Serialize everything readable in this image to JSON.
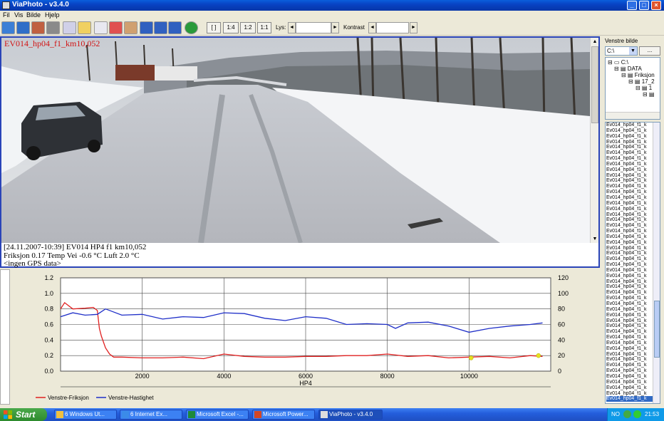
{
  "window": {
    "title": "ViaPhoto - v3.4.0"
  },
  "menu": [
    "Fil",
    "Vis",
    "Bilde",
    "Hjelp"
  ],
  "toolbar": {
    "icons": [
      "arrow-icon",
      "arrow-icon",
      "road-icon",
      "disk-icon",
      "printer-icon",
      "mail-icon",
      "document-icon",
      "chart-icon",
      "map-icon",
      "window-icon",
      "split-icon",
      "grid-icon",
      "globe-icon"
    ],
    "zoom_buttons": [
      "[ ]",
      "1:4",
      "1:2",
      "1:1"
    ],
    "brightness_label": "Lys:",
    "contrast_label": "Kontrast"
  },
  "photo": {
    "overlay_label": "EV014_hp04_f1_km10,052",
    "info_lines": [
      "[24.11.2007-10:39]  EV014 HP4 f1 km10,052",
      "Friksjon 0.17 Temp Vei -0.6 °C  Luft 2.0 °C",
      "<ingen GPS data>"
    ]
  },
  "chart_data": {
    "type": "line",
    "xlabel": "HP4",
    "xlim": [
      0,
      12000
    ],
    "ylim_left": [
      0.0,
      1.2
    ],
    "ylim_right": [
      0,
      120
    ],
    "x_ticks": [
      2000,
      4000,
      6000,
      8000,
      10000
    ],
    "y_ticks_left": [
      "0.0",
      "0.2",
      "0.4",
      "0.6",
      "0.8",
      "1.0",
      "1.2"
    ],
    "y_ticks_right": [
      "0",
      "20",
      "40",
      "60",
      "80",
      "100",
      "120"
    ],
    "grid": true,
    "legend_position": "bottom-left",
    "series": [
      {
        "name": "Venstre-Friksjon",
        "color": "#e02020",
        "axis": "left",
        "x": [
          0,
          100,
          300,
          600,
          800,
          900,
          950,
          1000,
          1100,
          1200,
          1300,
          1500,
          2000,
          2500,
          3000,
          3500,
          4000,
          4500,
          5000,
          5500,
          6000,
          6500,
          7000,
          7500,
          8000,
          8500,
          9000,
          9500,
          10000,
          10500,
          11000,
          11500,
          11800
        ],
        "values": [
          0.8,
          0.88,
          0.8,
          0.81,
          0.82,
          0.78,
          0.55,
          0.45,
          0.3,
          0.22,
          0.18,
          0.18,
          0.17,
          0.17,
          0.18,
          0.16,
          0.22,
          0.19,
          0.18,
          0.18,
          0.19,
          0.19,
          0.2,
          0.2,
          0.22,
          0.19,
          0.2,
          0.17,
          0.18,
          0.19,
          0.17,
          0.2,
          0.19
        ]
      },
      {
        "name": "Venstre-Hastighet",
        "color": "#1f2fc8",
        "axis": "right",
        "x": [
          0,
          300,
          600,
          900,
          1100,
          1200,
          1500,
          2000,
          2500,
          3000,
          3500,
          4000,
          4500,
          5000,
          5500,
          6000,
          6500,
          7000,
          7500,
          8000,
          8200,
          8500,
          9000,
          9500,
          10000,
          10500,
          11000,
          11500,
          11800
        ],
        "values": [
          70,
          75,
          72,
          73,
          80,
          78,
          72,
          73,
          67,
          70,
          69,
          75,
          74,
          68,
          65,
          70,
          68,
          60,
          61,
          60,
          55,
          62,
          63,
          58,
          50,
          55,
          58,
          60,
          62
        ]
      }
    ],
    "markers": [
      {
        "x": 10050,
        "y": 0.17,
        "color": "#e8e020"
      },
      {
        "x": 11700,
        "y": 0.2,
        "color": "#e8e020"
      }
    ]
  },
  "right_panel": {
    "label": "Venstre bilde",
    "drive": "C:\\",
    "browse_label": "...",
    "tree": [
      "C:\\",
      "DATA",
      "Friksjon",
      "17_2",
      "1"
    ],
    "file_prefix": "Ev014_hp04_f1_k",
    "file_count": 50,
    "selected_label": "Ev014_hp04_f1_k"
  },
  "taskbar": {
    "start_label": "Start",
    "tasks": [
      "6 Windows Ut...",
      "6 Internet Ex...",
      "Microsoft Excel -...",
      "Microsoft Power...",
      "ViaPhoto - v3.4.0"
    ],
    "tray_lang": "NO",
    "clock": "21:53"
  }
}
